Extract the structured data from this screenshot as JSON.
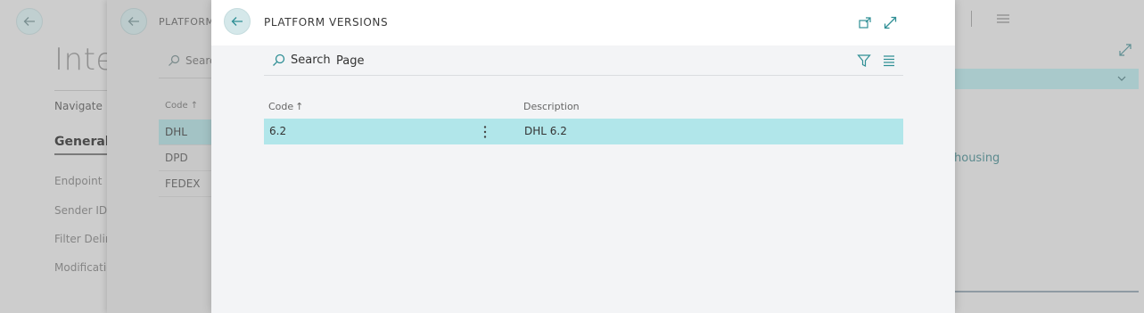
{
  "background": {
    "page_title": "Integ",
    "navigate_label": "Navigate",
    "general_label": "General",
    "fields": [
      "Endpoint",
      "Sender ID",
      "Filter Delim",
      "Modificatio"
    ],
    "warehousing_text": "ehousing"
  },
  "middle": {
    "title": "PLATFORM",
    "search_label": "Searc",
    "column_header": "Code",
    "rows": [
      "DHL",
      "DPD",
      "FEDEX"
    ]
  },
  "modal": {
    "title": "PLATFORM VERSIONS",
    "toolbar": {
      "search_label": "Search",
      "page_label": "Page"
    },
    "columns": {
      "code": "Code",
      "description": "Description"
    },
    "sort_indicator": "↑",
    "rows": [
      {
        "code": "6.2",
        "description": "DHL 6.2"
      }
    ]
  },
  "colors": {
    "accent": "#2f8f95",
    "selected_row": "#b1e6ea"
  },
  "icons": [
    "back-arrow-icon",
    "search-icon",
    "filter-icon",
    "list-view-icon",
    "popout-icon",
    "expand-icon",
    "menu-icon",
    "chevron-down-icon",
    "more-options-icon"
  ]
}
